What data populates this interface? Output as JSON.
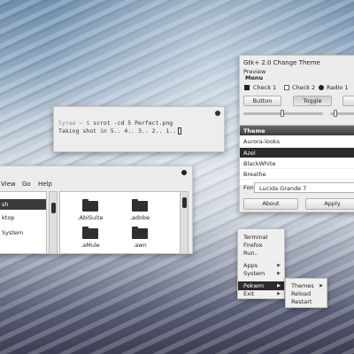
{
  "terminal": {
    "prompt": "lyrae ~ $",
    "command": "scrot -cd 5 Perfect.png",
    "output": "Taking shot in 5.. 4.. 3.. 2.. 1.."
  },
  "file_manager": {
    "menus": [
      "View",
      "Go",
      "Help"
    ],
    "sidebar": [
      "sh",
      "ktop",
      "System"
    ],
    "folders": [
      ".AbiSuite",
      ".adobe",
      ".aMule",
      ".awn"
    ]
  },
  "gtk": {
    "title": "Gtk+ 2.0 Change Theme",
    "preview_label": "Preview",
    "menu_label": "Menu",
    "checks": [
      "Check 1",
      "Check 2",
      "Radio 1"
    ],
    "buttons": {
      "button": "Button",
      "toggle": "Toggle"
    },
    "list_header": "Theme",
    "themes": [
      "Aurora-looks",
      "Azel",
      "BlackWhite",
      "Breathe"
    ],
    "selected_theme": "Azel",
    "font_label": "Font",
    "font_value": "Lucida Grande 7",
    "about": "About",
    "apply": "Apply"
  },
  "root_menu": {
    "items": [
      "Terminal",
      "Firefox",
      "Run..",
      "Apps",
      "System",
      "Pekwm",
      "Exit"
    ],
    "submenu": [
      "Themes",
      "Reload",
      "Restart"
    ]
  },
  "colors": {
    "accent": "#2b2b2b",
    "window_bg": "#ececec"
  }
}
